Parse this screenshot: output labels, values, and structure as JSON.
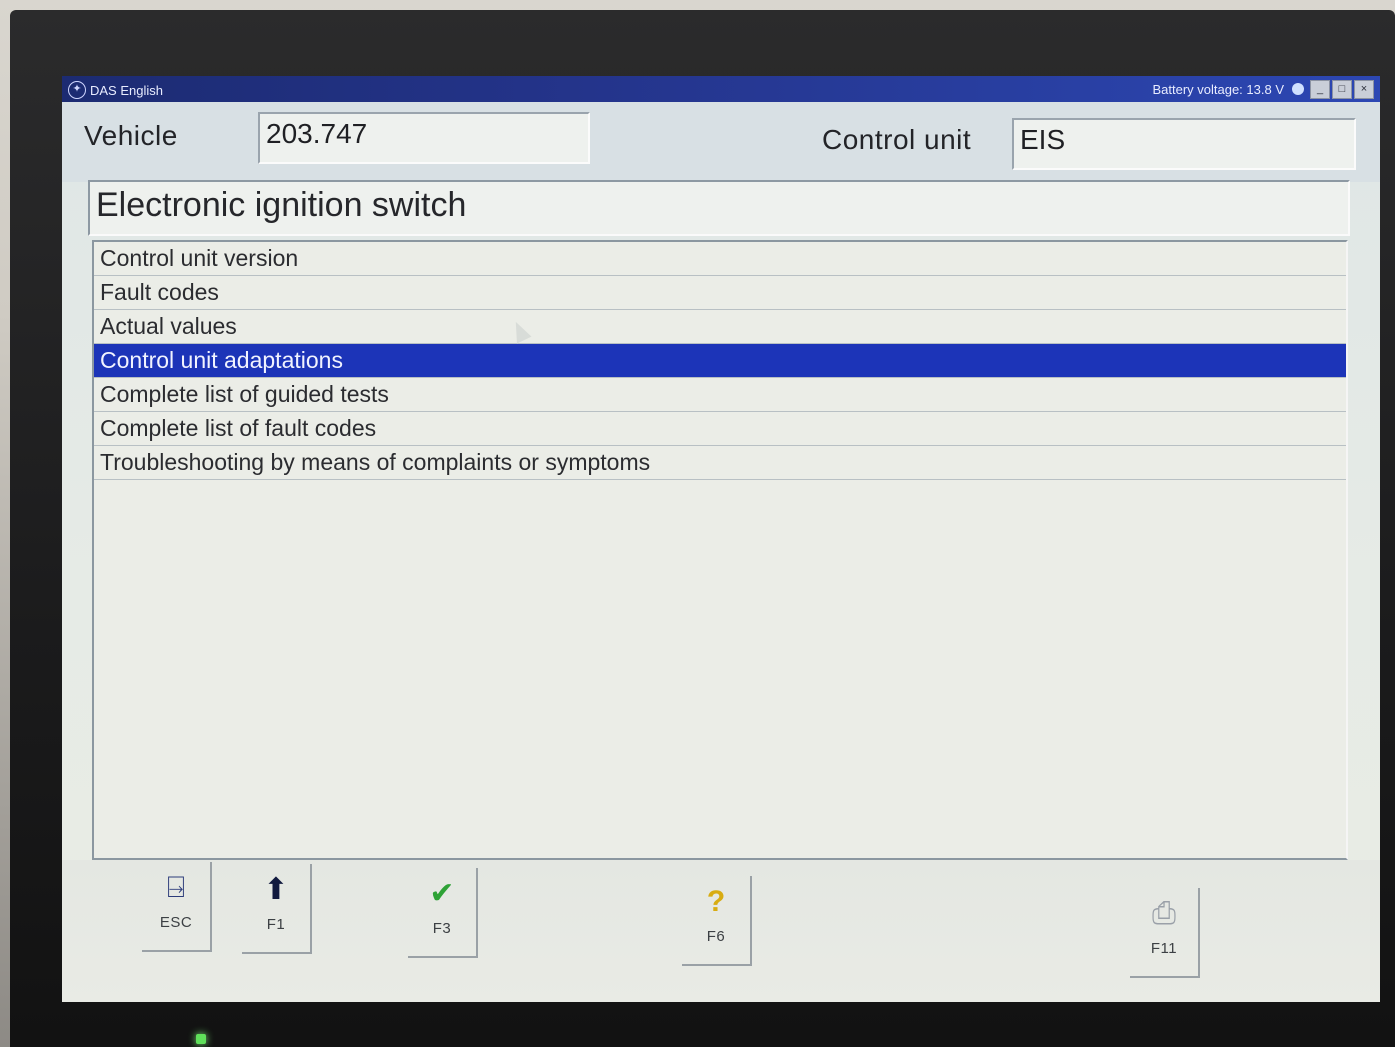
{
  "titlebar": {
    "app_name": "DAS English",
    "battery": "Battery voltage: 13.8 V"
  },
  "header": {
    "vehicle_label": "Vehicle",
    "vehicle_value": "203.747",
    "control_unit_label": "Control unit",
    "control_unit_value": "EIS"
  },
  "title": "Electronic ignition switch",
  "menu": {
    "items": [
      {
        "label": "Control unit version"
      },
      {
        "label": "Fault codes"
      },
      {
        "label": "Actual values"
      },
      {
        "label": "Control unit adaptations",
        "selected": true
      },
      {
        "label": "Complete list of guided tests"
      },
      {
        "label": "Complete list of fault codes"
      },
      {
        "label": "Troubleshooting by means of complaints or symptoms"
      }
    ]
  },
  "toolbar": {
    "esc": "ESC",
    "f1": "F1",
    "f3": "F3",
    "f6": "F6",
    "f11": "F11"
  },
  "icons": {
    "esc": "exit-door-icon",
    "f1": "up-arrow-icon",
    "f3": "checkmark-icon",
    "f6": "help-question-icon",
    "f11": "printer-icon"
  },
  "colors": {
    "selection": "#1c34b8",
    "titlebar": "#24348b"
  }
}
